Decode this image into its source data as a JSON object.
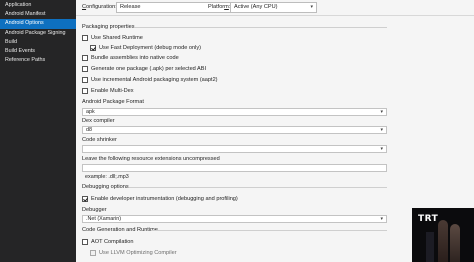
{
  "sidebar": {
    "items": [
      {
        "label": "Application",
        "active": false
      },
      {
        "label": "Android Manifest",
        "active": false
      },
      {
        "label": "Android Options",
        "active": true
      },
      {
        "label": "Android Package Signing",
        "active": false
      },
      {
        "label": "Build",
        "active": false
      },
      {
        "label": "Build Events",
        "active": false
      },
      {
        "label": "Reference Paths",
        "active": false
      }
    ]
  },
  "topbar": {
    "configuration_label_u": "C",
    "configuration_label_rest": "onfiguration:",
    "configuration_value": "Release",
    "platform_label_rest": "Platfor",
    "platform_label_u": "m",
    "platform_label_end": ":",
    "platform_value": "Active (Any CPU)"
  },
  "packaging": {
    "title": "Packaging properties",
    "use_shared_runtime": {
      "label": "Use Shared Runtime",
      "checked": false
    },
    "use_fast_deployment": {
      "label": "Use Fast Deployment (debug mode only)",
      "checked": true
    },
    "bundle_assemblies": {
      "label": "Bundle assemblies into native code",
      "checked": false
    },
    "generate_per_abi": {
      "label": "Generate one package (.apk) per selected ABI",
      "checked": false
    },
    "incremental_packaging": {
      "label": "Use incremental Android packaging system (aapt2)",
      "checked": false
    },
    "multidex": {
      "label": "Enable Multi-Dex",
      "checked": false
    },
    "package_format_label": "Android Package Format",
    "package_format_value": "apk",
    "dex_compiler_label": "Dex compiler",
    "dex_compiler_value": "d8",
    "code_shrinker_label": "Code shrinker",
    "code_shrinker_value": "",
    "uncompressed_label": "Leave the following resource extensions uncompressed",
    "uncompressed_value": "",
    "uncompressed_example": "example: .dll;.mp3"
  },
  "debugging": {
    "title": "Debugging options",
    "enable_instrumentation": {
      "label": "Enable developer instrumentation (debugging and profiling)",
      "checked": true
    },
    "debugger_label": "Debugger",
    "debugger_value": ".Net (Xamarin)"
  },
  "codegen": {
    "title": "Code Generation and Runtime",
    "aot": {
      "label": "AOT Compilation",
      "checked": false
    },
    "llvm": {
      "label": "Use LLVM Optimizing Compiler",
      "checked": false,
      "disabled": true
    }
  },
  "video_overlay": {
    "watermark": "TRT"
  },
  "icons": {
    "dropdown": "chevron-down-icon",
    "checkbox": "checkbox-icon"
  },
  "colors": {
    "sidebar_bg": "#252526",
    "active_item": "#0e70c0",
    "panel_bg": "#f5f5f5"
  }
}
